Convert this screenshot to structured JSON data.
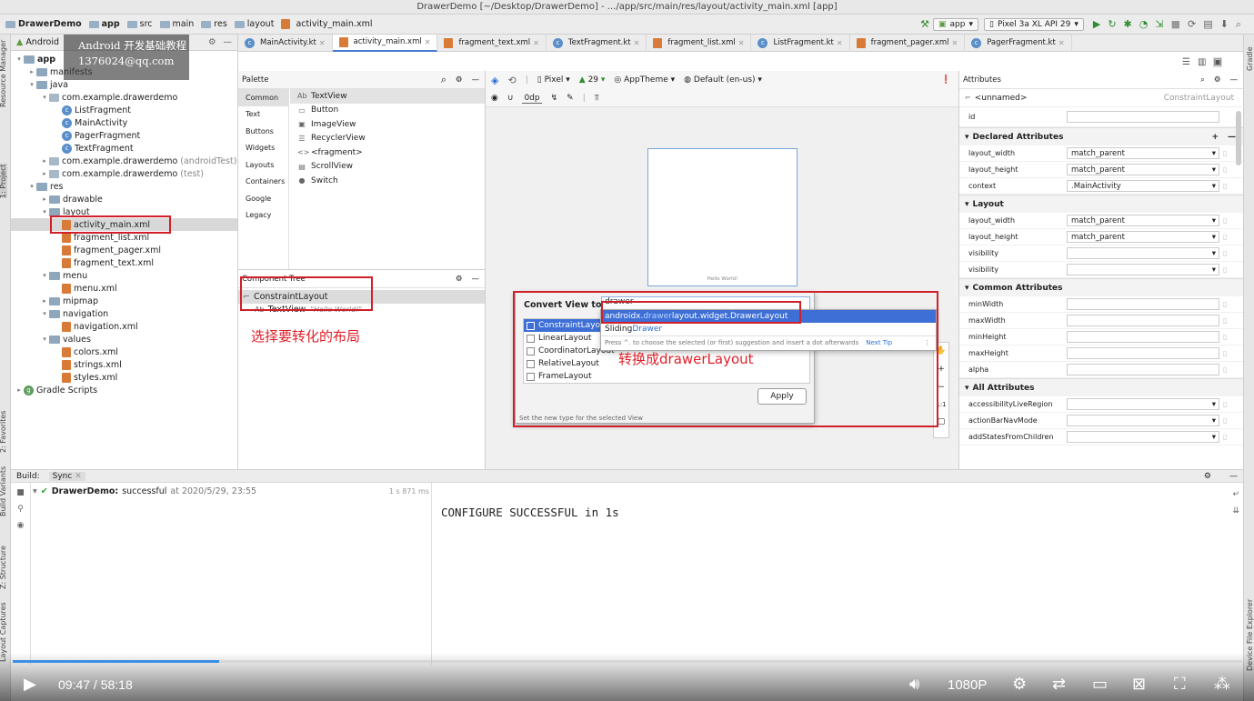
{
  "window_title": "DrawerDemo [~/Desktop/DrawerDemo] - .../app/src/main/res/layout/activity_main.xml [app]",
  "breadcrumb": [
    "DrawerDemo",
    "app",
    "src",
    "main",
    "res",
    "layout",
    "activity_main.xml"
  ],
  "toolbar": {
    "run_config": "app",
    "device": "Pixel 3a XL API 29"
  },
  "project_panel": {
    "view_mode": "Android",
    "tree": [
      {
        "label": "app",
        "level": 0,
        "type": "root",
        "bold": true
      },
      {
        "label": "manifests",
        "level": 1,
        "type": "folder"
      },
      {
        "label": "java",
        "level": 1,
        "type": "folder"
      },
      {
        "label": "com.example.drawerdemo",
        "level": 2,
        "type": "pkg"
      },
      {
        "label": "ListFragment",
        "level": 3,
        "type": "kt"
      },
      {
        "label": "MainActivity",
        "level": 3,
        "type": "kt"
      },
      {
        "label": "PagerFragment",
        "level": 3,
        "type": "kt"
      },
      {
        "label": "TextFragment",
        "level": 3,
        "type": "kt"
      },
      {
        "label": "com.example.drawerdemo",
        "suffix": "(androidTest)",
        "level": 2,
        "type": "pkg"
      },
      {
        "label": "com.example.drawerdemo",
        "suffix": "(test)",
        "level": 2,
        "type": "pkg"
      },
      {
        "label": "res",
        "level": 1,
        "type": "folder"
      },
      {
        "label": "drawable",
        "level": 2,
        "type": "folder"
      },
      {
        "label": "layout",
        "level": 2,
        "type": "folder"
      },
      {
        "label": "activity_main.xml",
        "level": 3,
        "type": "xml",
        "selected": true
      },
      {
        "label": "fragment_list.xml",
        "level": 3,
        "type": "xml"
      },
      {
        "label": "fragment_pager.xml",
        "level": 3,
        "type": "xml"
      },
      {
        "label": "fragment_text.xml",
        "level": 3,
        "type": "xml"
      },
      {
        "label": "menu",
        "level": 2,
        "type": "folder"
      },
      {
        "label": "menu.xml",
        "level": 3,
        "type": "xml"
      },
      {
        "label": "mipmap",
        "level": 2,
        "type": "folder"
      },
      {
        "label": "navigation",
        "level": 2,
        "type": "folder"
      },
      {
        "label": "navigation.xml",
        "level": 3,
        "type": "xml"
      },
      {
        "label": "values",
        "level": 2,
        "type": "folder"
      },
      {
        "label": "colors.xml",
        "level": 3,
        "type": "xml"
      },
      {
        "label": "strings.xml",
        "level": 3,
        "type": "xml"
      },
      {
        "label": "styles.xml",
        "level": 3,
        "type": "xml"
      },
      {
        "label": "Gradle Scripts",
        "level": 0,
        "type": "gradle"
      }
    ]
  },
  "watermark": {
    "line1": "Android 开发基础教程",
    "line2": "1376024@qq.com"
  },
  "editor_tabs": [
    "MainActivity.kt",
    "activity_main.xml",
    "fragment_text.xml",
    "TextFragment.kt",
    "fragment_list.xml",
    "ListFragment.kt",
    "fragment_pager.xml",
    "PagerFragment.kt"
  ],
  "palette": {
    "title": "Palette",
    "categories": [
      "Common",
      "Text",
      "Buttons",
      "Widgets",
      "Layouts",
      "Containers",
      "Google",
      "Legacy"
    ],
    "items": [
      {
        "icon": "Ab",
        "label": "TextView"
      },
      {
        "icon": "▭",
        "label": "Button"
      },
      {
        "icon": "▣",
        "label": "ImageView"
      },
      {
        "icon": "☰",
        "label": "RecyclerView"
      },
      {
        "icon": "<>",
        "label": "<fragment>"
      },
      {
        "icon": "▤",
        "label": "ScrollView"
      },
      {
        "icon": "●",
        "label": "Switch"
      }
    ]
  },
  "component_tree": {
    "title": "Component Tree",
    "root": "ConstraintLayout",
    "child_icon": "Ab",
    "child": "TextView",
    "child_value": "\"Hello World!\""
  },
  "annotations": {
    "select_layout": "选择要转化的布局",
    "convert_to": "转换成drawerLayout"
  },
  "design_toolbar": {
    "device": "Pixel",
    "api": "29",
    "theme": "AppTheme",
    "locale": "Default (en-us)",
    "margin": "0dp"
  },
  "canvas": {
    "hello_text": "Hello World!"
  },
  "convert_dialog": {
    "label": "Convert View to:",
    "input_value": "drawer",
    "views": [
      "ConstraintLayout",
      "LinearLayout",
      "CoordinatorLayout",
      "RelativeLayout",
      "FrameLayout"
    ],
    "apply": "Apply",
    "hint": "Set the new type for the selected View"
  },
  "autocomplete": {
    "item1_pre": "androidx.",
    "item1_match": "drawer",
    "item1_post": "layout.widget.DrawerLayout",
    "item2_pre": "Sliding",
    "item2_match": "Drawer",
    "footer": "Press ^. to choose the selected (or first) suggestion and insert a dot afterwards",
    "next_tip": "Next Tip"
  },
  "attributes": {
    "title": "Attributes",
    "component": "<unnamed>",
    "component_type": "ConstraintLayout",
    "id_label": "id",
    "declared_title": "Declared Attributes",
    "declared": [
      {
        "k": "layout_width",
        "v": "match_parent"
      },
      {
        "k": "layout_height",
        "v": "match_parent"
      },
      {
        "k": "context",
        "v": ".MainActivity"
      }
    ],
    "layout_title": "Layout",
    "layout": [
      {
        "k": "layout_width",
        "v": "match_parent"
      },
      {
        "k": "layout_height",
        "v": "match_parent"
      },
      {
        "k": "visibility",
        "v": ""
      },
      {
        "k": "visibility",
        "v": ""
      }
    ],
    "common_title": "Common Attributes",
    "common": [
      {
        "k": "minWidth",
        "v": ""
      },
      {
        "k": "maxWidth",
        "v": ""
      },
      {
        "k": "minHeight",
        "v": ""
      },
      {
        "k": "maxHeight",
        "v": ""
      },
      {
        "k": "alpha",
        "v": ""
      }
    ],
    "all_title": "All Attributes",
    "all": [
      {
        "k": "accessibilityLiveRegion",
        "v": ""
      },
      {
        "k": "actionBarNavMode",
        "v": ""
      },
      {
        "k": "addStatesFromChildren",
        "v": ""
      }
    ]
  },
  "build": {
    "label": "Build:",
    "tab": "Sync",
    "project": "DrawerDemo:",
    "status": "successful",
    "time": "at 2020/5/29, 23:55",
    "duration": "1 s 871 ms",
    "console": "CONFIGURE SUCCESSFUL in 1s"
  },
  "side_tabs": {
    "left": [
      "Resource Manager",
      "1: Project",
      "2: Favorites",
      "Build Variants",
      "Z: Structure",
      "Layout Captures"
    ],
    "right": [
      "Gradle",
      "Device File Explorer"
    ]
  },
  "video": {
    "current": "09:47",
    "total": "58:18",
    "quality": "1080P",
    "progress_fraction": 0.168
  },
  "colors": {
    "accent": "#3d6fd6",
    "annotation_red": "#e0202a",
    "progress": "#3a8ee6"
  }
}
